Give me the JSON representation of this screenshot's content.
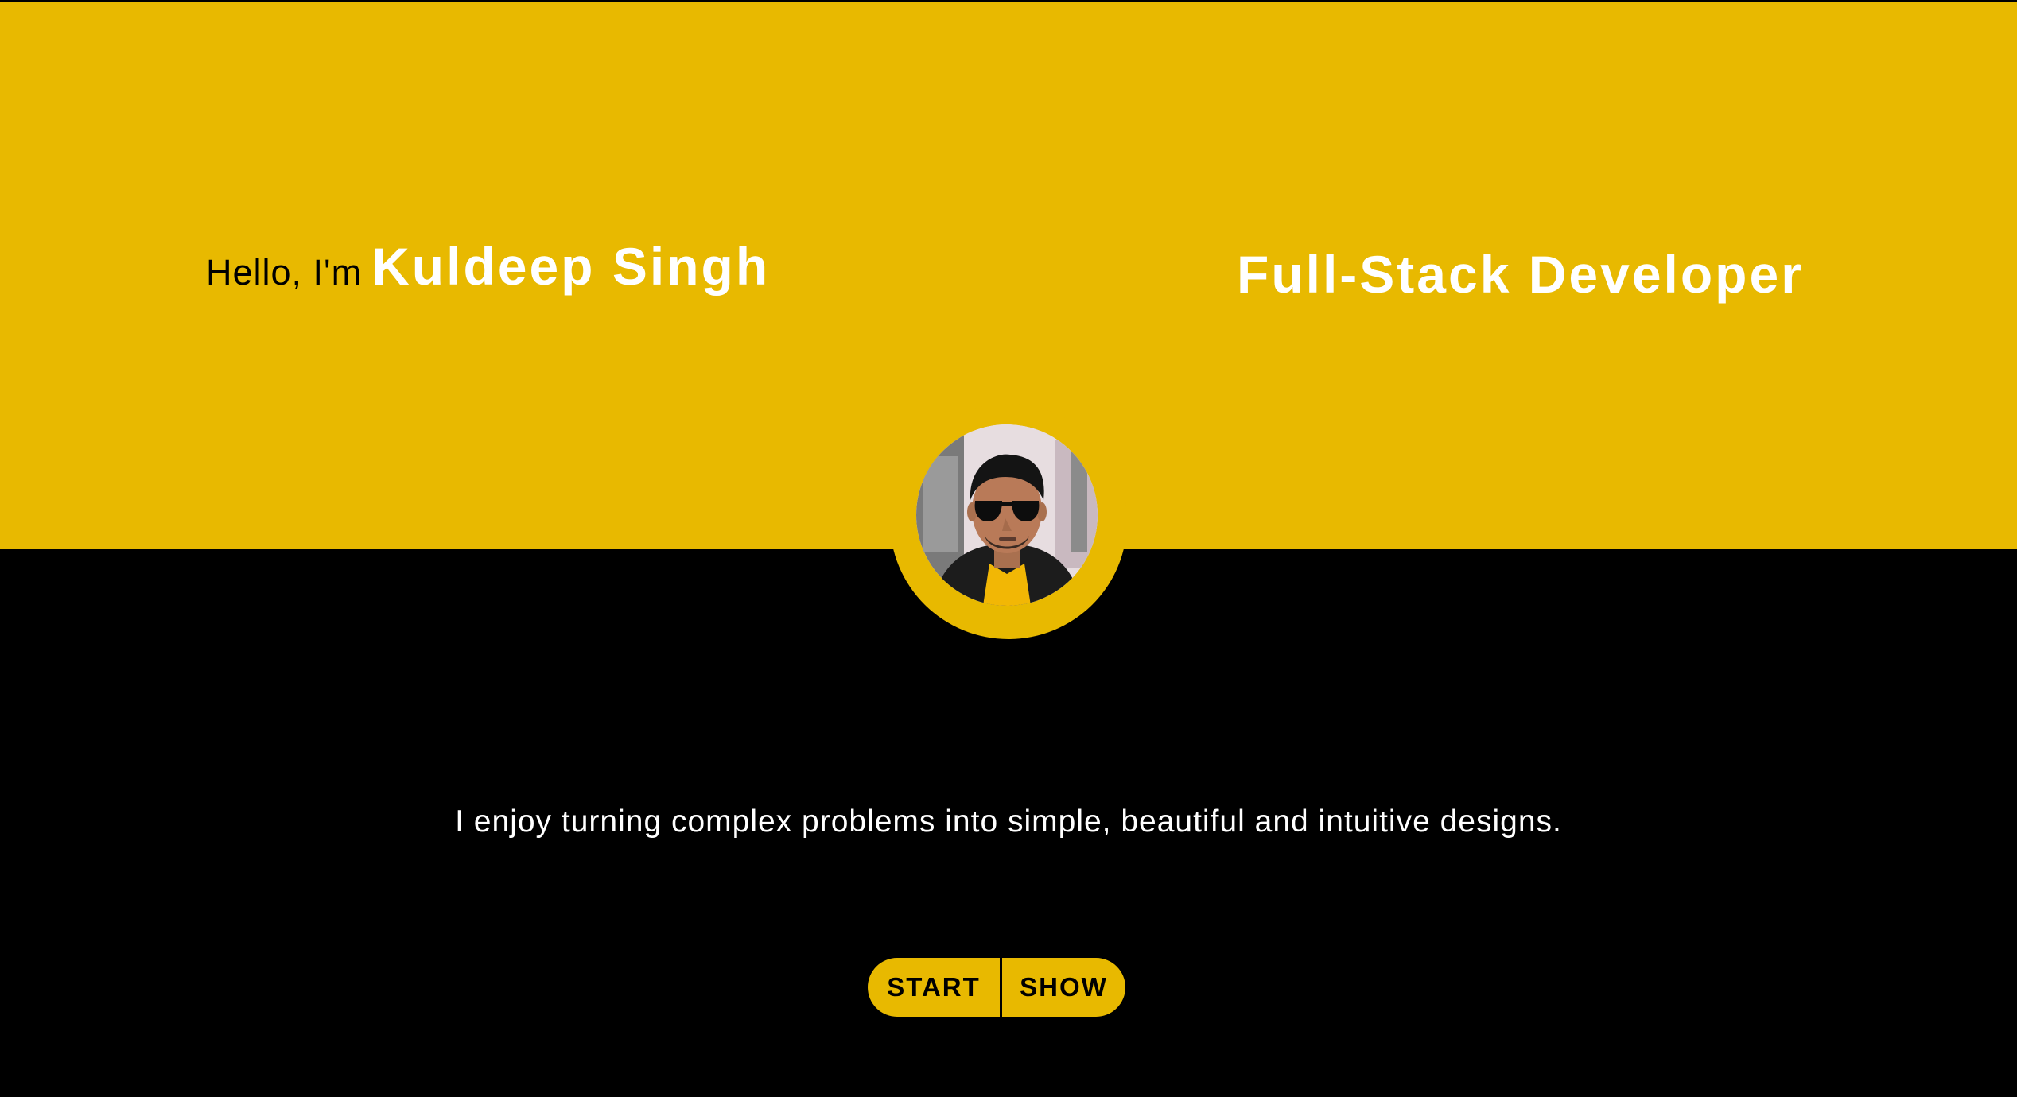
{
  "hero": {
    "greeting_prefix": "Hello, I'm",
    "name": "Kuldeep Singh",
    "role": "Full-Stack Developer"
  },
  "avatar": {
    "icon": "profile-photo",
    "alt": "Kuldeep Singh"
  },
  "tagline": "I enjoy turning complex problems into simple, beautiful and intuitive designs.",
  "buttons": {
    "start_label": "START",
    "show_label": "SHOW"
  },
  "colors": {
    "accent": "#E8B900",
    "background": "#000000",
    "text_light": "#FFFFFF",
    "text_dark": "#000000"
  }
}
